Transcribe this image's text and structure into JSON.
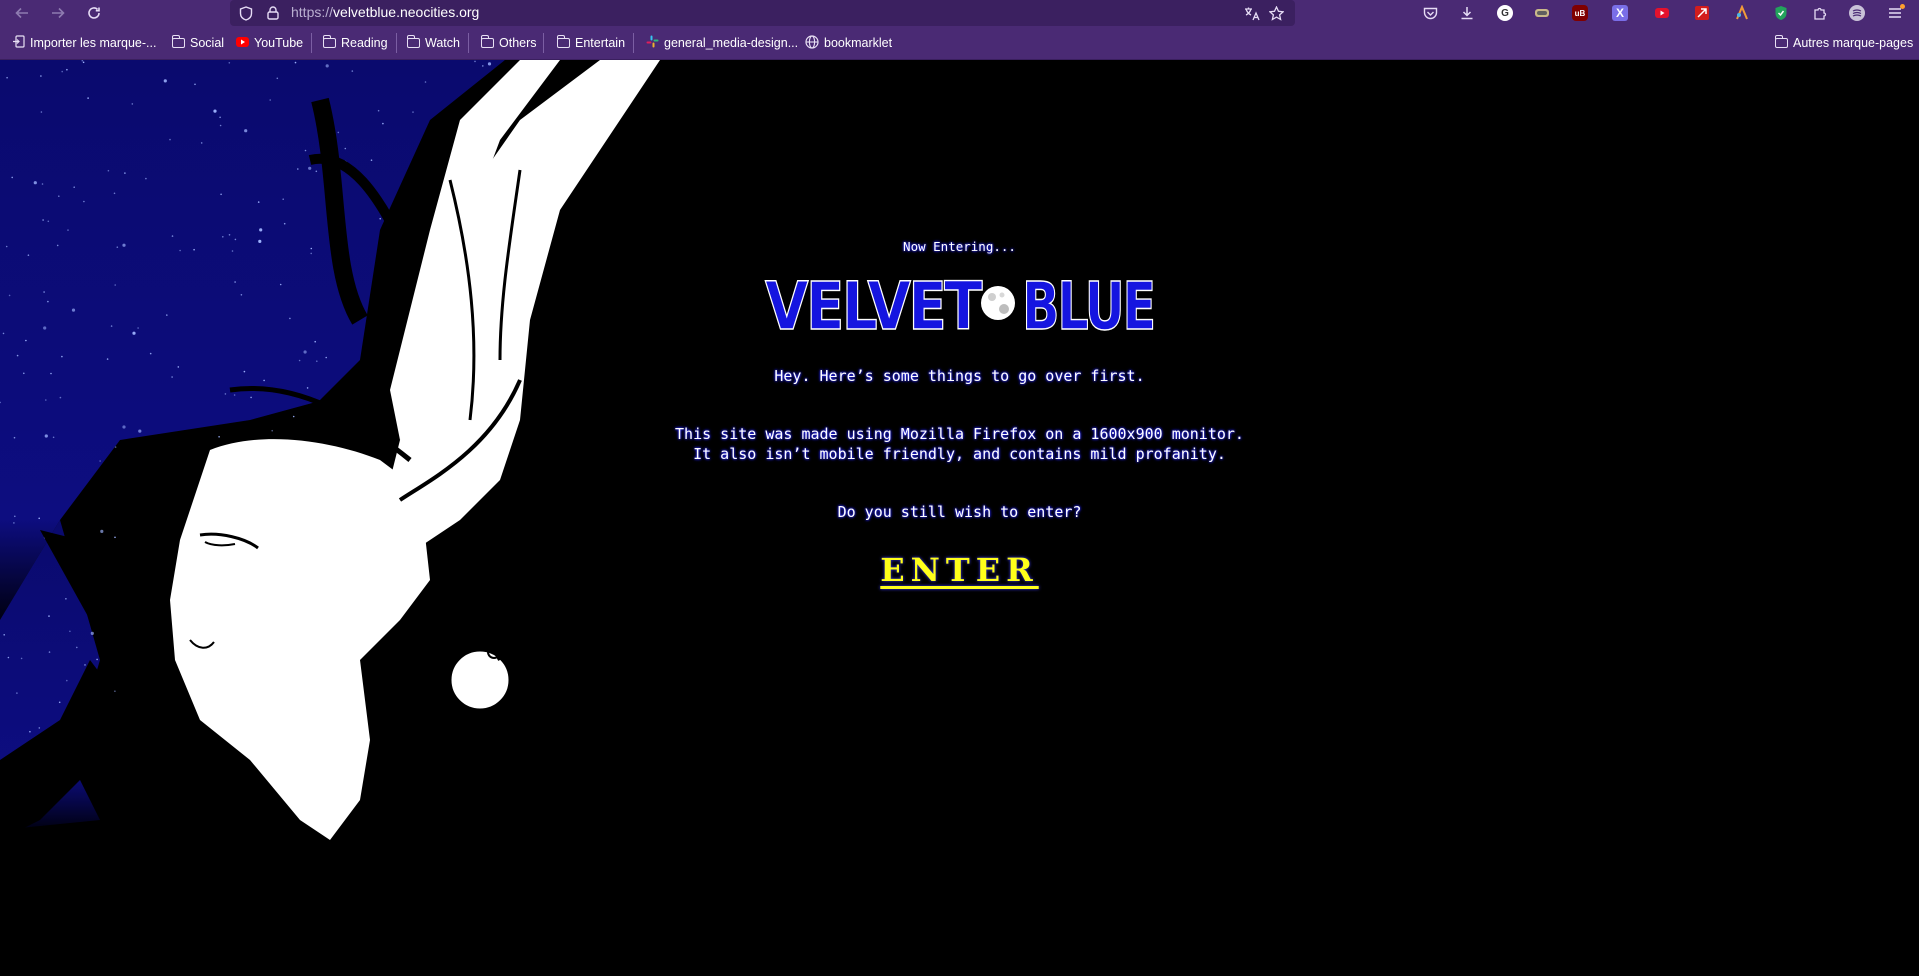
{
  "browser": {
    "url_prefix": "https://",
    "url_domain": "velvetblue.neocities.org",
    "icons": {
      "back": "back-arrow-icon",
      "forward": "forward-arrow-icon",
      "reload": "reload-icon",
      "tracking_protection": "shield-icon",
      "lock": "lock-icon",
      "translate": "translate-icon",
      "bookmark_star": "star-icon"
    },
    "extensions": [
      "pocket-icon",
      "downloads-icon",
      "google-icon",
      "extension-icon",
      "ublock-icon",
      "x-icon",
      "youtube-extension-icon",
      "red-extension-icon",
      "extension-icon",
      "green-shield-icon",
      "extensions-puzzle-icon",
      "account-icon",
      "menu-icon"
    ],
    "extension_letters": {
      "google": "G",
      "x": "X",
      "ublock": "uB"
    }
  },
  "bookmarks": {
    "items": [
      {
        "label": "Importer les marque-...",
        "icon": "import-icon"
      },
      {
        "label": "Social",
        "icon": "folder-icon"
      },
      {
        "label": "YouTube",
        "icon": "youtube-icon"
      },
      {
        "label": "Reading",
        "icon": "folder-icon"
      },
      {
        "label": "Watch",
        "icon": "folder-icon"
      },
      {
        "label": "Others",
        "icon": "folder-icon"
      },
      {
        "label": "Entertain",
        "icon": "folder-icon"
      },
      {
        "label": "general_media-design...",
        "icon": "slack-icon"
      },
      {
        "label": "bookmarklet",
        "icon": "globe-icon"
      }
    ],
    "other_bookmarks": "Autres marque-pages"
  },
  "page": {
    "now_entering": "Now Entering...",
    "logo_left": "VELVET",
    "logo_right": "BLUE",
    "hey": "Hey. Here’s some things to go over first.",
    "info_line1": "This site was made using Mozilla Firefox on a 1600x900 monitor.",
    "info_line2": "It also isn’t mobile friendly, and contains mild profanity.",
    "wish": "Do you still wish to enter?",
    "enter": "ENTER"
  },
  "colors": {
    "chrome": "#4a2a74",
    "urlbar": "#3b2060",
    "page_bg": "#000000",
    "night_sky": "#0a0a6e",
    "logo_blue": "#1515e0",
    "enter_yellow": "#ffff1a"
  }
}
